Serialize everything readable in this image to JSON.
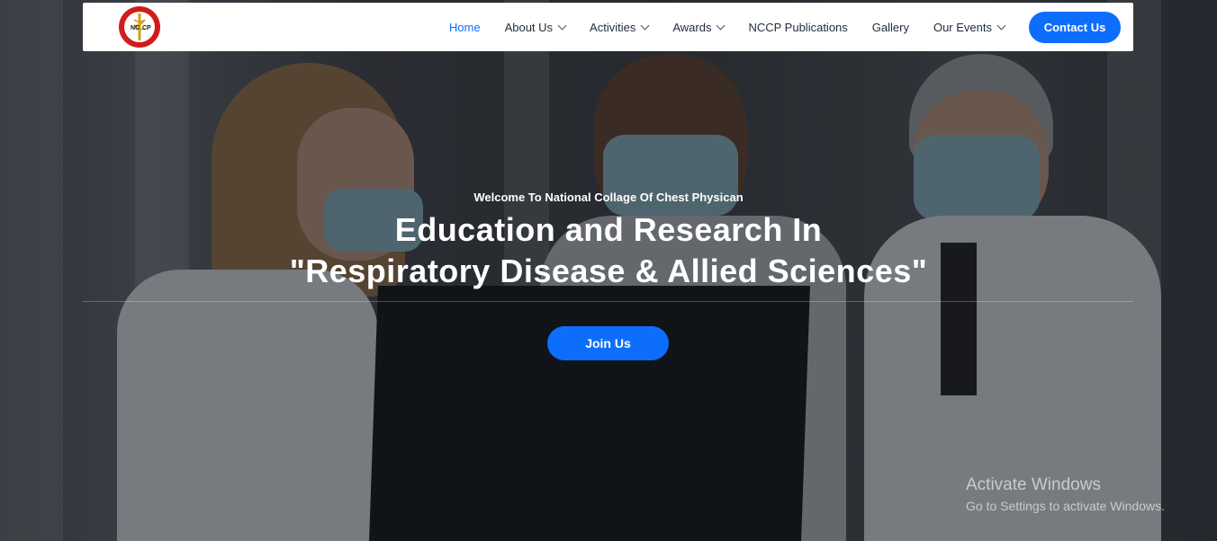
{
  "brand": {
    "logo_text": "NC CP",
    "logo_colors": {
      "ring": "#d01c1c",
      "fill": "#ffffff",
      "staff": "#d4a017"
    }
  },
  "nav": {
    "items": [
      {
        "label": "Home",
        "active": true,
        "dropdown": false
      },
      {
        "label": "About Us",
        "active": false,
        "dropdown": true
      },
      {
        "label": "Activities",
        "active": false,
        "dropdown": true
      },
      {
        "label": "Awards",
        "active": false,
        "dropdown": true
      },
      {
        "label": "NCCP Publications",
        "active": false,
        "dropdown": false
      },
      {
        "label": "Gallery",
        "active": false,
        "dropdown": false
      },
      {
        "label": "Our Events",
        "active": false,
        "dropdown": true
      }
    ],
    "contact_label": "Contact Us"
  },
  "hero": {
    "welcome": "Welcome To National Collage Of Chest Physican",
    "headline_line1": "Education and Research In",
    "headline_line2": "\"Respiratory Disease & Allied Sciences\"",
    "join_label": "Join Us"
  },
  "watermark": {
    "title": "Activate Windows",
    "subtitle": "Go to Settings to activate Windows."
  },
  "colors": {
    "accent": "#0d6efd",
    "nav_text": "#1f2b3a",
    "white": "#ffffff"
  }
}
